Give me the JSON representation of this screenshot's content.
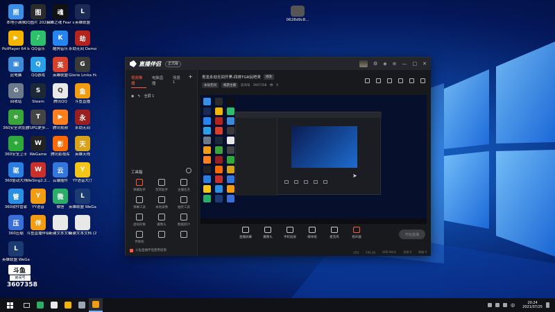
{
  "desktop": {
    "icons": [
      {
        "label": "本地小满照",
        "color": "#3a8ee6",
        "glyph": "照"
      },
      {
        "label": "QQ图片 20210405...",
        "color": "#2b2b2b",
        "glyph": "图"
      },
      {
        "label": "英雄之魂 Fear sou...",
        "color": "#111111",
        "glyph": "魂"
      },
      {
        "label": "英雄联盟",
        "color": "#1b2a55",
        "glyph": "L"
      },
      {
        "label": "PotPlayer 64 bit",
        "color": "#f5b400",
        "glyph": "▶"
      },
      {
        "label": "QQ音乐",
        "color": "#2dbf6c",
        "glyph": "♪"
      },
      {
        "label": "酷狗音乐",
        "color": "#2585f0",
        "glyph": "K"
      },
      {
        "label": "永劫无间 Demo",
        "color": "#b4231d",
        "glyph": "劫"
      },
      {
        "label": "此电脑",
        "color": "#3c8ad8",
        "glyph": "▣"
      },
      {
        "label": "QQ游戏",
        "color": "#2a9fe8",
        "glyph": "Q"
      },
      {
        "label": "英雄联盟",
        "color": "#d8402c",
        "glyph": "英"
      },
      {
        "label": "Glorie Lmka Han Xiong...",
        "color": "#3a3a3a",
        "glyph": "G"
      },
      {
        "label": "回收站",
        "color": "#6d7a8c",
        "glyph": "♻"
      },
      {
        "label": "Steam",
        "color": "#1b2838",
        "glyph": "S"
      },
      {
        "label": "腾讯QQ",
        "color": "#e8e8e8",
        "glyph": "Q"
      },
      {
        "label": "斗鱼直播",
        "color": "#f39c12",
        "glyph": "鱼"
      },
      {
        "label": "360安全浏览器",
        "color": "#3aa63a",
        "glyph": "e"
      },
      {
        "label": "TUPG更多...",
        "color": "#444444",
        "glyph": "T"
      },
      {
        "label": "腾讯视频",
        "color": "#ff7f1e",
        "glyph": "▶"
      },
      {
        "label": "永劫无间",
        "color": "#9b1f1f",
        "glyph": "永"
      },
      {
        "label": "360安全卫士",
        "color": "#2eaa3a",
        "glyph": "+"
      },
      {
        "label": "WeGame",
        "color": "#222222",
        "glyph": "W"
      },
      {
        "label": "腾讯影视库",
        "color": "#ff6a00",
        "glyph": "影"
      },
      {
        "label": "英雄天线",
        "color": "#d8a21a",
        "glyph": "天"
      },
      {
        "label": "360驱动大师",
        "color": "#2a7de1",
        "glyph": "驱"
      },
      {
        "label": "WeSing2.2...",
        "color": "#c8302a",
        "glyph": "W"
      },
      {
        "label": "云端插件",
        "color": "#3377dd",
        "glyph": "云"
      },
      {
        "label": "YY语音大厅",
        "color": "#f5c518",
        "glyph": "Y"
      },
      {
        "label": "360软件管家",
        "color": "#2a8ee1",
        "glyph": "管"
      },
      {
        "label": "YY语音",
        "color": "#f39c12",
        "glyph": "Y"
      },
      {
        "label": "微信",
        "color": "#2aae67",
        "glyph": "微"
      },
      {
        "label": "英雄联盟 WeGame版",
        "color": "#1d3b73",
        "glyph": "L"
      },
      {
        "label": "360压缩",
        "color": "#3b6fd8",
        "glyph": "压"
      },
      {
        "label": "斗鱼直播伴侣",
        "color": "#f39c12",
        "glyph": "伴"
      },
      {
        "label": "新建文本文档",
        "color": "#e8e8e8",
        "glyph": ""
      },
      {
        "label": "新建文本文档 (2)",
        "color": "#e8e8e8",
        "glyph": ""
      },
      {
        "label": "英雄联盟 WeGame版",
        "color": "#1d3b73",
        "glyph": "L"
      }
    ],
    "top_icon_label": "0628d9c8..."
  },
  "watermark": {
    "badge_text": "斗鱼",
    "room_label": "房间号",
    "room_number": "3607358"
  },
  "app": {
    "title": "直播伴侣",
    "version_badge": "正式版",
    "tabs": [
      "视频推播",
      "电脑直播",
      "场景1"
    ],
    "add_scene": "+",
    "scene_items": [
      "◉",
      "✎",
      "全屏 1"
    ],
    "tools_title": "工具箱",
    "tools": [
      {
        "label": "弹幕助手",
        "red": true
      },
      {
        "label": "贵宾助手",
        "red": false
      },
      {
        "label": "主播任务",
        "red": false
      },
      {
        "label": "弹幕工具",
        "red": false
      },
      {
        "label": "本地录像",
        "red": false
      },
      {
        "label": "抽奖工具",
        "red": false
      },
      {
        "label": "虚拟形象",
        "red": false
      },
      {
        "label": "摄像头",
        "red": false
      },
      {
        "label": "数据统计",
        "red": false
      },
      {
        "label": "伴奏机",
        "red": false
      },
      {
        "label": "",
        "red": false
      },
      {
        "label": "",
        "red": false
      }
    ],
    "notice": "斗鱼直播伴侣使用指南",
    "room_title": "青龙永劫无间开黑-四排TGR玩吧来",
    "room_title_tag": "修改",
    "room_meta": {
      "category_chip": "永劫无间",
      "secondary_chip": "端游主播",
      "room_label": "房间号",
      "room_number": "3607358",
      "viewers": "0"
    },
    "bottom_buttons": [
      "直播屏幕",
      "摄像头",
      "手机投屏",
      "媒体组",
      "麦克风",
      "扬声器"
    ],
    "start_live": "开始直播",
    "status_items": [
      "CPU",
      "FPS:30",
      "码率:0kb/s",
      "丢帧:0",
      "网络 0"
    ]
  },
  "taskbar": {
    "apps": [
      {
        "name": "wechat",
        "color": "#2aae67"
      },
      {
        "name": "browser",
        "color": "#e8e8e8"
      },
      {
        "name": "wegame",
        "color": "#f5b400"
      },
      {
        "name": "steam",
        "color": "#9aa6b8"
      },
      {
        "name": "douyu-companion",
        "color": "#f39c12"
      }
    ],
    "time": "20:24",
    "date": "2021/07/25",
    "lang": "中"
  }
}
